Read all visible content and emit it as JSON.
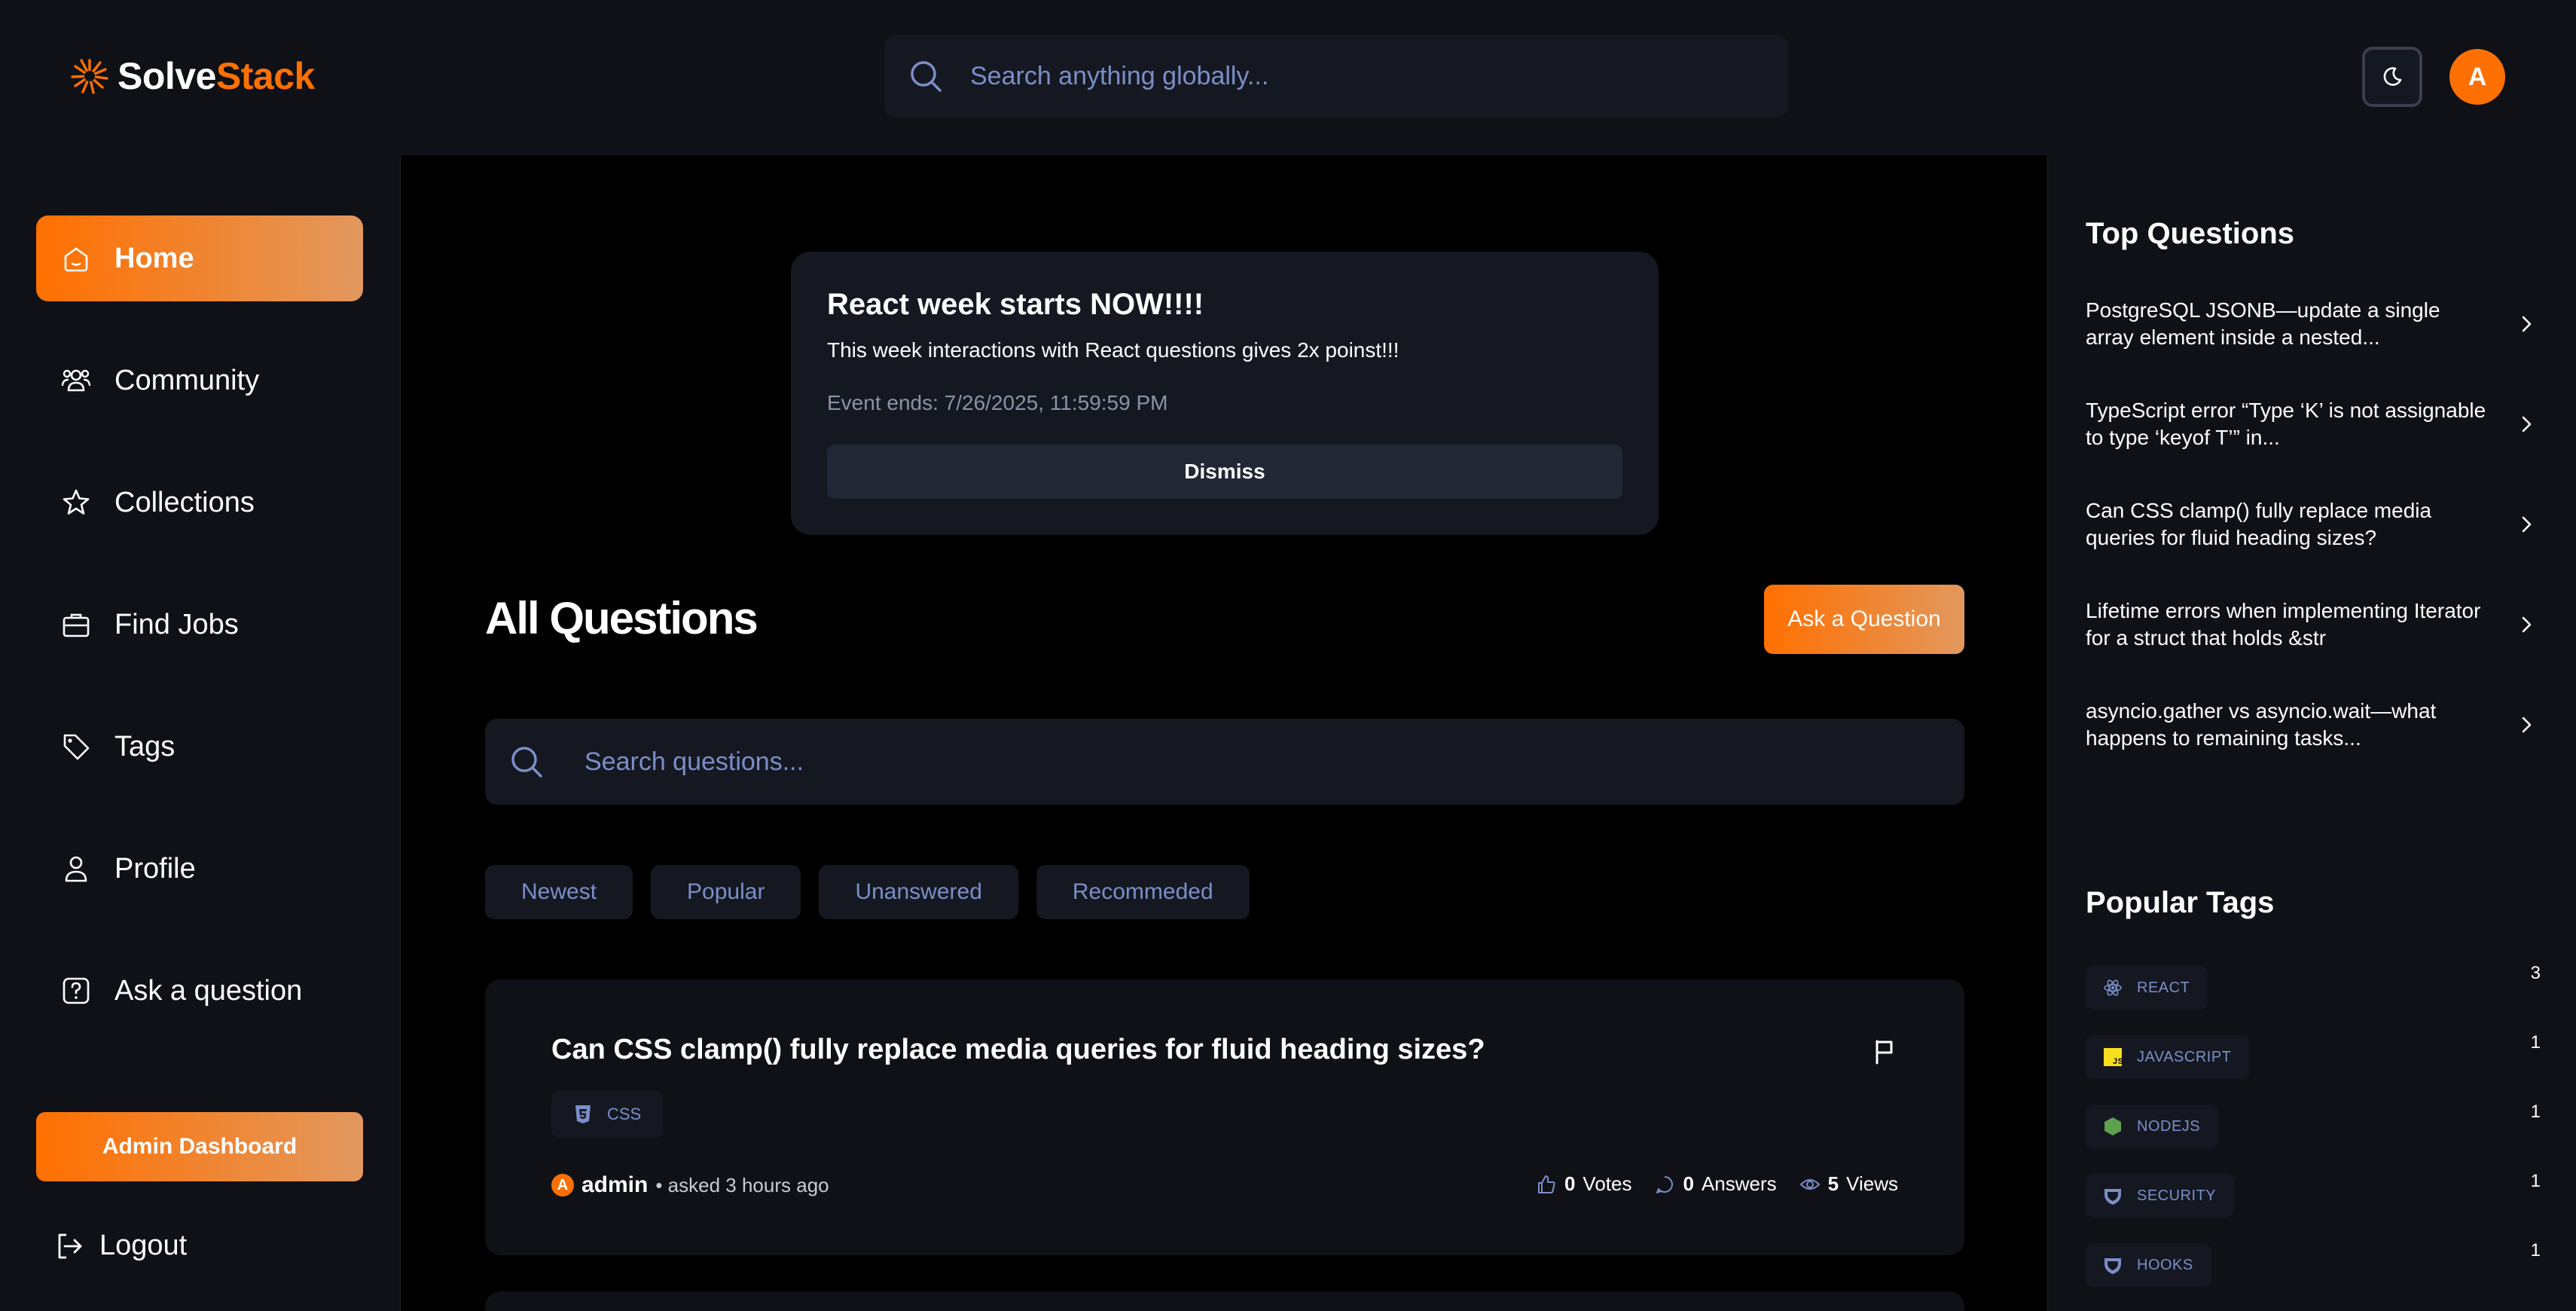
{
  "app": {
    "brand_main": "Solve",
    "brand_accent": "Stack",
    "accent_color": "#ff7000"
  },
  "header": {
    "search_placeholder": "Search anything globally...",
    "avatar_initial": "A",
    "theme_icon": "moon-icon"
  },
  "sidebar": {
    "items": [
      {
        "label": "Home",
        "icon": "home-icon",
        "active": true
      },
      {
        "label": "Community",
        "icon": "users-icon",
        "active": false
      },
      {
        "label": "Collections",
        "icon": "star-icon",
        "active": false
      },
      {
        "label": "Find Jobs",
        "icon": "briefcase-icon",
        "active": false
      },
      {
        "label": "Tags",
        "icon": "tag-icon",
        "active": false
      },
      {
        "label": "Profile",
        "icon": "user-icon",
        "active": false
      },
      {
        "label": "Ask a question",
        "icon": "question-icon",
        "active": false
      }
    ],
    "admin_label": "Admin Dashboard",
    "logout_label": "Logout"
  },
  "banner": {
    "title": "React week starts NOW!!!!",
    "description": "This week interactions with React questions gives 2x poinst!!!",
    "ends": "Event ends: 7/26/2025, 11:59:59 PM",
    "dismiss_label": "Dismiss"
  },
  "main": {
    "title": "All Questions",
    "ask_label": "Ask a Question",
    "search_placeholder": "Search questions...",
    "filters": [
      "Newest",
      "Popular",
      "Unanswered",
      "Recommeded"
    ],
    "questions": [
      {
        "title": "Can CSS clamp() fully replace media queries for fluid heading sizes?",
        "tag": "CSS",
        "author": "admin",
        "author_initial": "A",
        "asked": "• asked 3 hours ago",
        "votes": "0",
        "votes_label": "Votes",
        "answers": "0",
        "answers_label": "Answers",
        "views": "5",
        "views_label": "Views"
      }
    ]
  },
  "rightbar": {
    "top_title": "Top Questions",
    "top_questions": [
      "PostgreSQL JSONB—update a single array element inside a nested...",
      "TypeScript error “Type ‘K’ is not assignable to type ‘keyof T’” in...",
      "Can CSS clamp() fully replace media queries for fluid heading sizes?",
      "Lifetime errors when implementing Iterator for a struct that holds &str",
      "asyncio.gather vs asyncio.wait—what happens to remaining tasks..."
    ],
    "tags_title": "Popular Tags",
    "tags": [
      {
        "name": "REACT",
        "count": "3",
        "icon": "react-icon"
      },
      {
        "name": "JAVASCRIPT",
        "count": "1",
        "icon": "javascript-icon"
      },
      {
        "name": "NODEJS",
        "count": "1",
        "icon": "nodejs-icon"
      },
      {
        "name": "SECURITY",
        "count": "1",
        "icon": "security-icon"
      },
      {
        "name": "HOOKS",
        "count": "1",
        "icon": "hooks-icon"
      }
    ]
  }
}
